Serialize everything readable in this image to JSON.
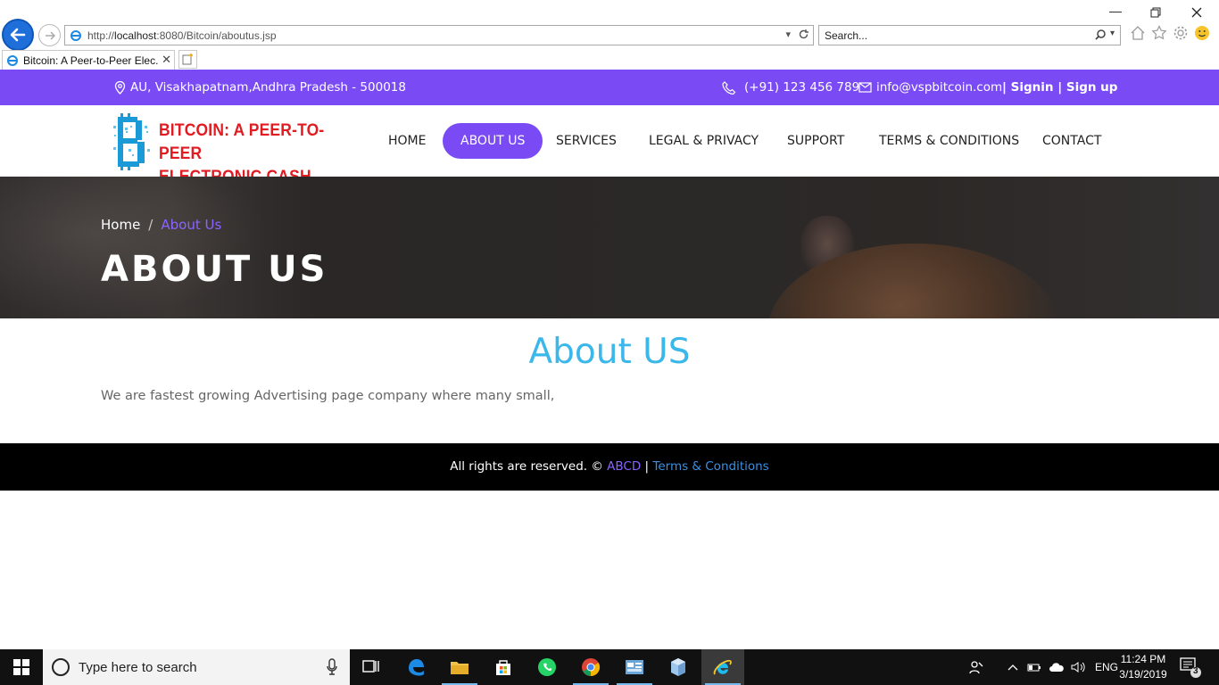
{
  "browser": {
    "url_prefix": "http://",
    "url_host": "localhost",
    "url_rest": ":8080/Bitcoin/aboutus.jsp",
    "search_placeholder": "Search...",
    "tab_title": "Bitcoin: A Peer-to-Peer Elec..."
  },
  "topbar": {
    "address": "AU, Visakhapatnam,Andhra Pradesh - 500018",
    "phone": "(+91) 123 456 789",
    "email": "info@vspbitcoin.com",
    "auth_sep1": "| ",
    "signin": "Signin",
    "auth_sep2": " | ",
    "signup": "Sign up"
  },
  "logo": {
    "line1": "BITCOIN: A PEER-TO-PEER",
    "line2": "ELECTRONIC CASH SYSTEM"
  },
  "nav": {
    "items": [
      {
        "label": "HOME"
      },
      {
        "label": "ABOUT US"
      },
      {
        "label": "SERVICES"
      },
      {
        "label": "LEGAL & PRIVACY"
      },
      {
        "label": "SUPPORT"
      },
      {
        "label": "TERMS & CONDITIONS"
      },
      {
        "label": "CONTACT"
      }
    ]
  },
  "hero": {
    "breadcrumb_home": "Home",
    "breadcrumb_sep": "/",
    "breadcrumb_current": "About Us",
    "title": "ABOUT US"
  },
  "content": {
    "title": "About US",
    "text": "We are fastest growing Advertising page company where many small,"
  },
  "footer": {
    "prefix": "All rights are reserved. © ",
    "brand": "ABCD",
    "sep": " | ",
    "terms": "Terms & Conditions"
  },
  "taskbar": {
    "search_placeholder": "Type here to search",
    "lang": "ENG",
    "time": "11:24 PM",
    "date": "3/19/2019",
    "notifications": "3"
  },
  "colors": {
    "accent_purple": "#7a4bf5",
    "title_blue": "#3bb7ea",
    "logo_red": "#e01b22"
  }
}
